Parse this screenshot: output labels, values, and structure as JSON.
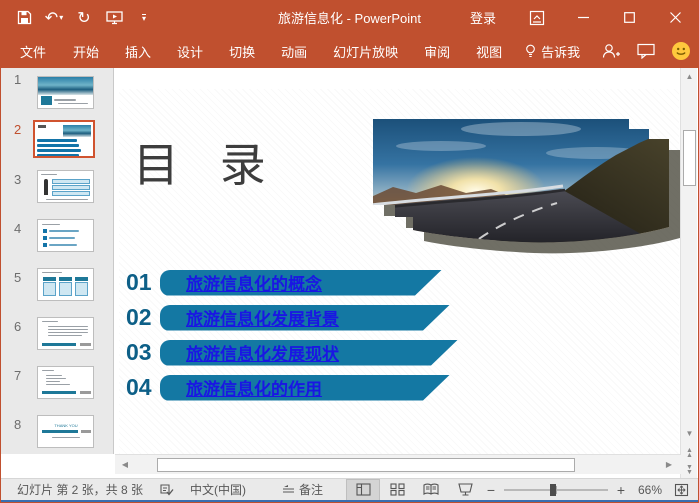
{
  "window": {
    "title": "旅游信息化  -  PowerPoint",
    "signin": "登录",
    "accent_color": "#C0502F"
  },
  "ribbon": {
    "tabs": [
      "文件",
      "开始",
      "插入",
      "设计",
      "切换",
      "动画",
      "幻灯片放映",
      "审阅",
      "视图"
    ],
    "tell_me": "告诉我"
  },
  "slide_panel": {
    "selected": 2,
    "slides": [
      {
        "num": "1"
      },
      {
        "num": "2"
      },
      {
        "num": "3"
      },
      {
        "num": "4"
      },
      {
        "num": "5"
      },
      {
        "num": "6"
      },
      {
        "num": "7"
      },
      {
        "num": "8"
      }
    ]
  },
  "slide": {
    "title": "目 录",
    "toc": [
      {
        "num": "01",
        "label": "旅游信息化的概念"
      },
      {
        "num": "02",
        "label": "旅游信息化发展背景"
      },
      {
        "num": "03",
        "label": "旅游信息化发展现状"
      },
      {
        "num": "04",
        "label": "旅游信息化的作用"
      }
    ],
    "banner_color": "#1478A3",
    "link_color": "#1A16E3",
    "number_color": "#0D5F87"
  },
  "status_bar": {
    "slide_info": "幻灯片 第 2 张，共 8 张",
    "language": "中文(中国)",
    "notes": "备注",
    "zoom": "66%"
  }
}
